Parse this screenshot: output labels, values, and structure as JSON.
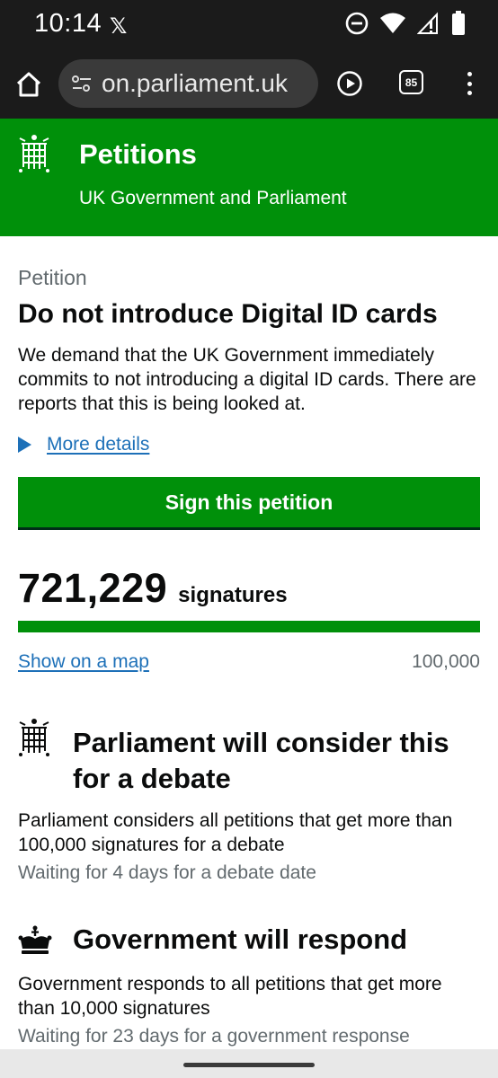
{
  "status_bar": {
    "time": "10:14",
    "x_glyph": "𝕏",
    "icons": [
      "do-not-disturb-icon",
      "wifi-icon",
      "signal-icon",
      "battery-icon"
    ]
  },
  "browser": {
    "url": "on.parliament.uk",
    "tab_count": "85",
    "icons": [
      "home-icon",
      "tune-icon",
      "play-icon",
      "tabs-icon",
      "more-vert-icon"
    ]
  },
  "header": {
    "title": "Petitions",
    "subtitle": "UK Government and Parliament",
    "logo": "portcullis-icon",
    "background": "#00900a"
  },
  "petition": {
    "caption": "Petition",
    "title": "Do not introduce Digital ID cards",
    "description": "We demand that the UK Government immediately commits to not introducing a digital ID cards. There are reports that this is being looked at.",
    "more_details": "More details",
    "sign_button": "Sign this petition"
  },
  "signatures": {
    "count": "721,229",
    "label": "signatures",
    "progress_fraction": 1.0,
    "map_link": "Show on a map",
    "threshold": "100,000"
  },
  "thresholds": [
    {
      "icon": "portcullis-icon",
      "title": "Parliament will consider this for a debate",
      "description": "Parliament considers all petitions that get more than 100,000 signatures for a debate",
      "status": "Waiting for 4 days for a debate date"
    },
    {
      "icon": "crown-icon",
      "title": "Government will respond",
      "description": "Government responds to all petitions that get more than 10,000 signatures",
      "status": "Waiting for 23 days for a government response"
    }
  ],
  "colors": {
    "brand_green": "#00900a",
    "link_blue": "#1d70b8",
    "secondary_text": "#626a6e"
  }
}
